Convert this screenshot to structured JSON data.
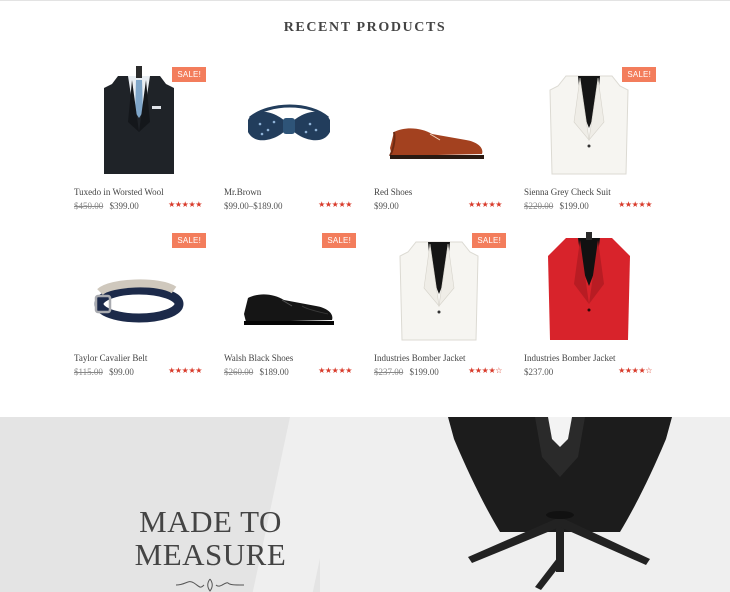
{
  "section": {
    "title": "RECENT PRODUCTS"
  },
  "products": [
    {
      "name": "Tuxedo in Worsted Wool",
      "old_price": "$450.00",
      "price": "$399.00",
      "sale": "SALE!",
      "rating": 5,
      "image": "suit-dark"
    },
    {
      "name": "Mr.Brown",
      "old_price": "",
      "price": "$99.00–$189.00",
      "sale": "",
      "rating": 5,
      "image": "bowtie"
    },
    {
      "name": "Red Shoes",
      "old_price": "",
      "price": "$99.00",
      "sale": "",
      "rating": 5,
      "image": "shoe-brown"
    },
    {
      "name": "Sienna Grey Check Suit",
      "old_price": "$220.00",
      "price": "$199.00",
      "sale": "SALE!",
      "rating": 5,
      "image": "jacket-white"
    },
    {
      "name": "Taylor Cavalier Belt",
      "old_price": "$115.00",
      "price": "$99.00",
      "sale": "SALE!",
      "rating": 5,
      "image": "belt"
    },
    {
      "name": "Walsh Black Shoes",
      "old_price": "$260.00",
      "price": "$189.00",
      "sale": "SALE!",
      "rating": 5,
      "image": "shoe-black"
    },
    {
      "name": "Industries Bomber Jacket",
      "old_price": "$237.00",
      "price": "$199.00",
      "sale": "SALE!",
      "rating": 4,
      "image": "jacket-white"
    },
    {
      "name": "Industries Bomber Jacket",
      "old_price": "",
      "price": "$237.00",
      "sale": "",
      "rating": 4,
      "image": "jacket-red"
    }
  ],
  "banner": {
    "line1": "MADE TO",
    "line2": "MEASURE"
  },
  "colors": {
    "sale_badge": "#f37d5c",
    "stars": "#d83a2a"
  }
}
